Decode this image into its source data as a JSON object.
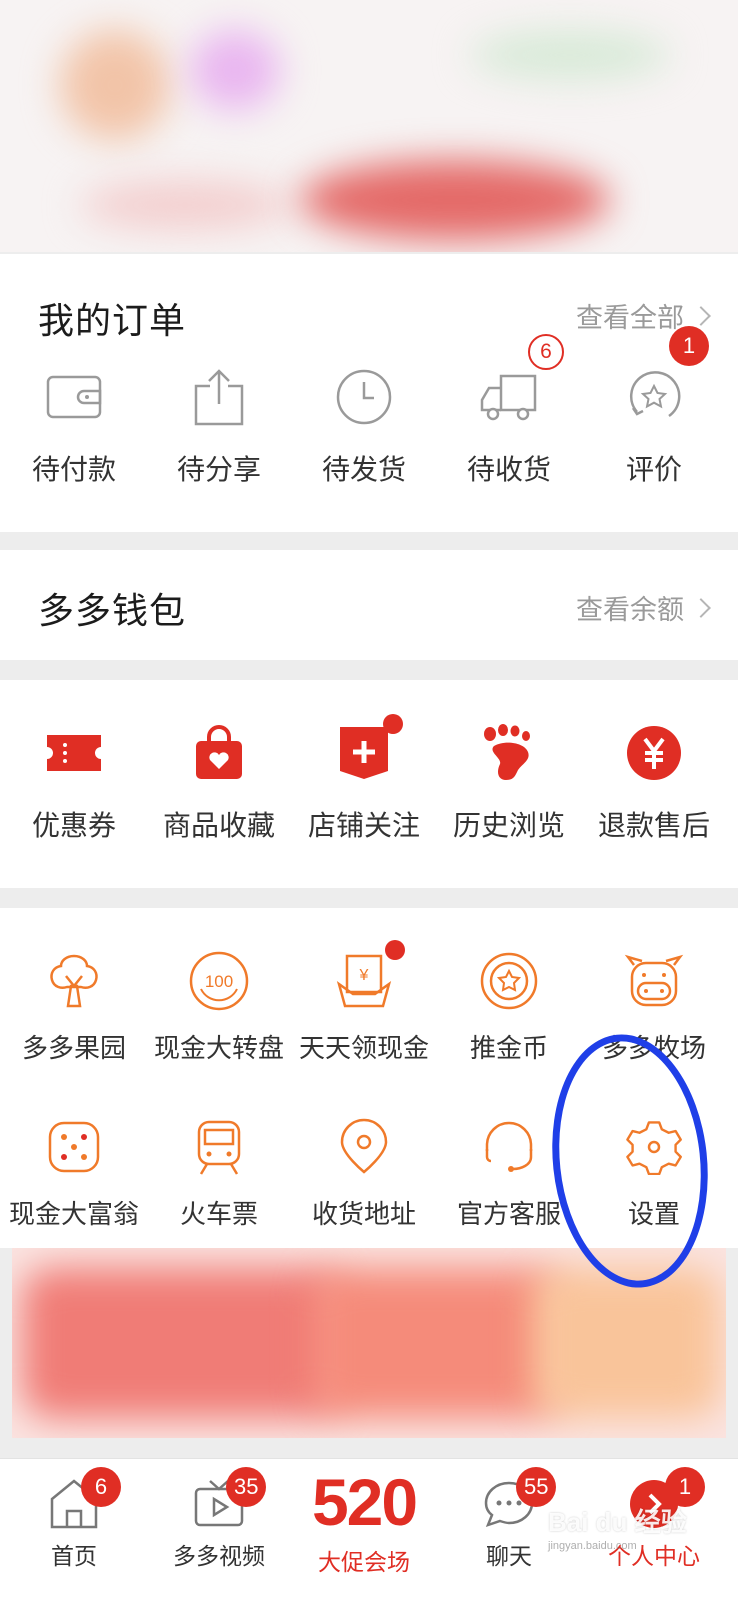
{
  "orders": {
    "title": "我的订单",
    "view_all": "查看全部",
    "items": [
      {
        "label": "待付款",
        "icon": "wallet-icon"
      },
      {
        "label": "待分享",
        "icon": "share-icon"
      },
      {
        "label": "待发货",
        "icon": "clock-icon"
      },
      {
        "label": "待收货",
        "icon": "truck-icon",
        "badge": "6"
      },
      {
        "label": "评价",
        "icon": "review-star-icon",
        "badge": "1"
      }
    ]
  },
  "wallet": {
    "title": "多多钱包",
    "view_balance": "查看余额"
  },
  "quick": {
    "items": [
      {
        "label": "优惠券",
        "icon": "coupon-icon"
      },
      {
        "label": "商品收藏",
        "icon": "favorites-bag-icon"
      },
      {
        "label": "店铺关注",
        "icon": "store-follow-icon"
      },
      {
        "label": "历史浏览",
        "icon": "footprint-icon"
      },
      {
        "label": "退款售后",
        "icon": "refund-yen-icon"
      }
    ]
  },
  "services": {
    "row1": [
      {
        "label": "多多果园",
        "icon": "tree-icon"
      },
      {
        "label": "现金大转盘",
        "icon": "wheel-100-icon"
      },
      {
        "label": "天天领现金",
        "icon": "cash-envelope-icon"
      },
      {
        "label": "推金币",
        "icon": "coin-icon"
      },
      {
        "label": "多多牧场",
        "icon": "cow-icon"
      }
    ],
    "row2": [
      {
        "label": "现金大富翁",
        "icon": "dice-icon"
      },
      {
        "label": "火车票",
        "icon": "train-icon"
      },
      {
        "label": "收货地址",
        "icon": "location-pin-icon"
      },
      {
        "label": "官方客服",
        "icon": "headset-icon"
      },
      {
        "label": "设置",
        "icon": "settings-gear-icon"
      }
    ]
  },
  "tabbar": {
    "items": [
      {
        "label": "首页",
        "badge": "6",
        "icon": "home-icon"
      },
      {
        "label": "多多视频",
        "badge": "35",
        "icon": "video-icon"
      },
      {
        "label": "大促会场",
        "big": "520",
        "icon": "promo-520-icon"
      },
      {
        "label": "聊天",
        "badge": "55",
        "icon": "chat-icon"
      },
      {
        "label": "个人中心",
        "badge": "1",
        "icon": "profile-icon"
      }
    ]
  },
  "watermark": {
    "text": "Bai du 经验",
    "sub": "jingyan.baidu.com"
  },
  "colors": {
    "accent": "#e02e24",
    "orange": "#f07a2a",
    "annotation": "#1f3fe8"
  }
}
